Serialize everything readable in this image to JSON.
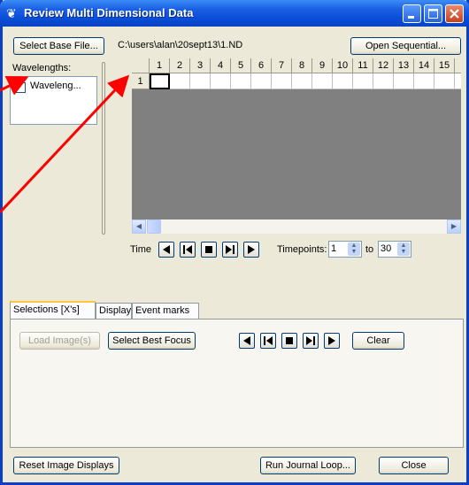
{
  "window": {
    "title": "Review Multi Dimensional Data",
    "title_icon": "butterfly-icon",
    "controls": [
      "minimize-icon",
      "maximize-icon",
      "close-icon"
    ],
    "colors": {
      "titlebar": "#0a4ed8",
      "face": "#ece9d8",
      "grid_bg": "#808080",
      "annotation_arrow": "#ff0000"
    }
  },
  "top": {
    "select_base_file": "Select Base File...",
    "file_path": "C:\\users\\alan\\20sept13\\1.ND",
    "open_sequential": "Open Sequential..."
  },
  "wavelengths": {
    "label": "Wavelengths:",
    "items": [
      {
        "label": "Waveleng...",
        "checked": false
      }
    ]
  },
  "grid": {
    "columns": [
      "1",
      "2",
      "3",
      "4",
      "5",
      "6",
      "7",
      "8",
      "9",
      "10",
      "11",
      "12",
      "13",
      "14",
      "15"
    ],
    "rows": [
      "1"
    ],
    "selected_cell": "1,1"
  },
  "time": {
    "label": "Time",
    "timepoints_label": "Timepoints:",
    "from": "1",
    "to_label": "to",
    "to": "30"
  },
  "tabs": [
    {
      "label": "Selections [X's]",
      "active": true
    },
    {
      "label": "Display",
      "active": false
    },
    {
      "label": "Event marks",
      "active": false
    }
  ],
  "selections": {
    "load_images": "Load Image(s)",
    "select_best_focus": "Select Best Focus",
    "clear": "Clear"
  },
  "bottom": {
    "reset_image_displays": "Reset Image Displays",
    "run_journal_loop": "Run Journal Loop...",
    "close": "Close"
  }
}
